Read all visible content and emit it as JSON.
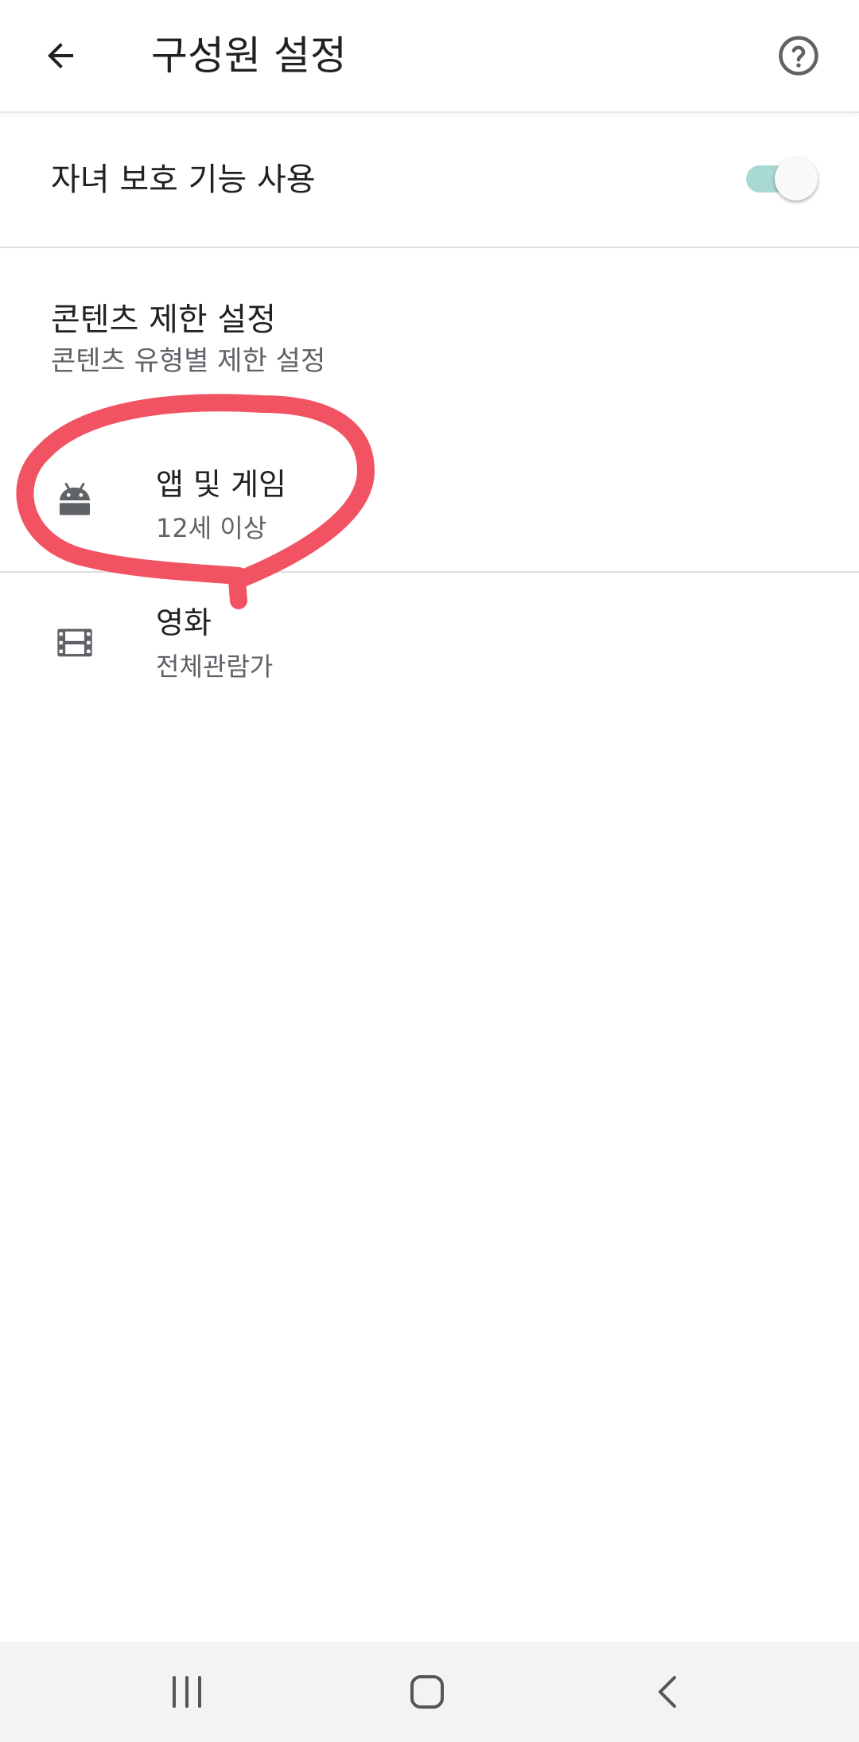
{
  "app_bar": {
    "title": "구성원 설정",
    "back_icon": "arrow-back-icon",
    "help_icon": "help-circle-icon"
  },
  "parental_controls": {
    "label": "자녀 보호 기능 사용",
    "enabled": true,
    "toggle_track_color": "#a9d9d3"
  },
  "content_restrictions": {
    "title": "콘텐츠 제한 설정",
    "subtitle": "콘텐츠 유형별 제한 설정",
    "items": [
      {
        "icon": "android-icon",
        "title": "앱 및 게임",
        "value": "12세 이상"
      },
      {
        "icon": "film-icon",
        "title": "영화",
        "value": "전체관람가"
      }
    ]
  },
  "annotation": {
    "color": "#f04a5a",
    "target": "앱 및 게임"
  },
  "nav_bar": {
    "buttons": [
      "recents-icon",
      "home-icon",
      "back-chevron-icon"
    ]
  }
}
